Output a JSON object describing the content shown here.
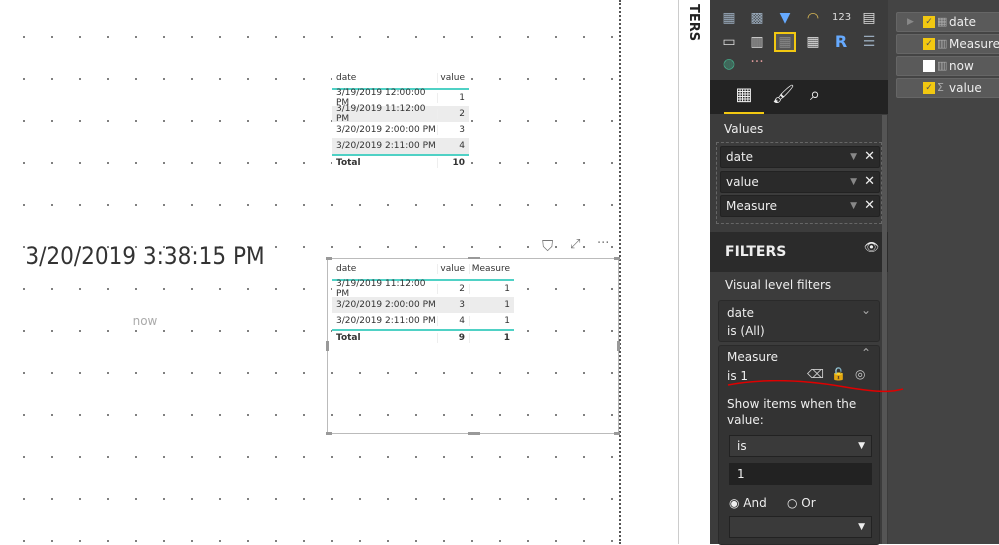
{
  "table1": {
    "headers": [
      "date",
      "value"
    ],
    "rows": [
      [
        "3/19/2019 12:00:00 PM",
        "1"
      ],
      [
        "3/19/2019 11:12:00 PM",
        "2"
      ],
      [
        "3/20/2019 2:00:00 PM",
        "3"
      ],
      [
        "3/20/2019 2:11:00 PM",
        "4"
      ]
    ],
    "total": [
      "Total",
      "10"
    ]
  },
  "table2": {
    "headers": [
      "date",
      "value",
      "Measure"
    ],
    "rows": [
      [
        "3/19/2019 11:12:00 PM",
        "2",
        "1"
      ],
      [
        "3/20/2019 2:00:00 PM",
        "3",
        "1"
      ],
      [
        "3/20/2019 2:11:00 PM",
        "4",
        "1"
      ]
    ],
    "total": [
      "Total",
      "9",
      "1"
    ]
  },
  "card": {
    "value": "3/20/2019 3:38:15 PM",
    "label": "now"
  },
  "filters_pane_collapsed_label": "TERS",
  "viz_pane": {
    "values_label": "Values",
    "values": [
      "date",
      "value",
      "Measure"
    ],
    "filters_title": "FILTERS",
    "visual_level_label": "Visual level filters",
    "filter_date": {
      "field": "date",
      "state": "is (All)"
    },
    "filter_measure": {
      "field": "Measure",
      "state": "is 1",
      "prompt": "Show items when the value:",
      "operator": "is",
      "value": "1",
      "and_label": "And",
      "or_label": "Or"
    },
    "more": "···"
  },
  "fields": [
    {
      "name": "date",
      "checked": true,
      "icon": "table-icon"
    },
    {
      "name": "Measure",
      "checked": true,
      "icon": "calculator-icon"
    },
    {
      "name": "now",
      "checked": false,
      "icon": "calculator-icon"
    },
    {
      "name": "value",
      "checked": true,
      "icon": "sigma-icon"
    }
  ],
  "colors": {
    "accent": "#f2c811",
    "table_line": "#4fd1c5",
    "annotation": "#e00000"
  }
}
